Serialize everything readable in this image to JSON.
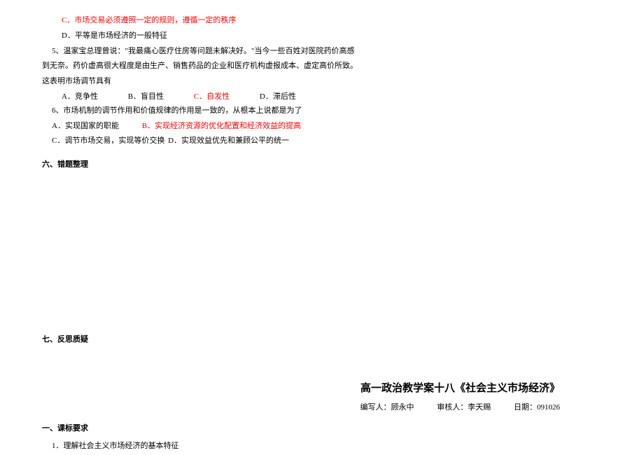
{
  "q4": {
    "optC": "C．市场交易必须遵照一定的规则，遵循一定的秩序",
    "optD": "D．平等是市场经济的一般特征"
  },
  "q5": {
    "line1": "5、温家宝总理曾说：\"我最痛心医疗住房等问题未解决好。\"当今一些百姓对医院药价高感",
    "line2": "到无奈。药价虚高很大程度是由生产、销售药品的企业和医疗机构虚报成本、虚定高价所致。",
    "line3": "这表明市场调节具有",
    "optA": "A．竞争性",
    "optB": "B．盲目性",
    "optC": "C．自发性",
    "optD": "D．滞后性"
  },
  "q6": {
    "line1": "6、市场机制的调节作用和价值规律的作用是一致的，从根本上说都是为了",
    "optA": "A．实现国家的职能",
    "optB": "B．实现经济资源的优化配置和经济效益的提高",
    "optC": "C．调节市场交易，实现等价交换",
    "optD": "D．实现效益优先和兼顾公平的统一"
  },
  "sections": {
    "six": "六、错题整理",
    "seven": "七、反思质疑"
  },
  "lesson": {
    "title": "高一政治教学案十八《社会主义市场经济》",
    "author_label": "编写人：",
    "author": "顾永中",
    "reviewer_label": "审核人：",
    "reviewer": "李天赐",
    "date_label": "日期：",
    "date": "091026"
  },
  "sec1": {
    "heading": "一、课标要求",
    "item1": "1．理解社会主义市场经济的基本特征"
  }
}
